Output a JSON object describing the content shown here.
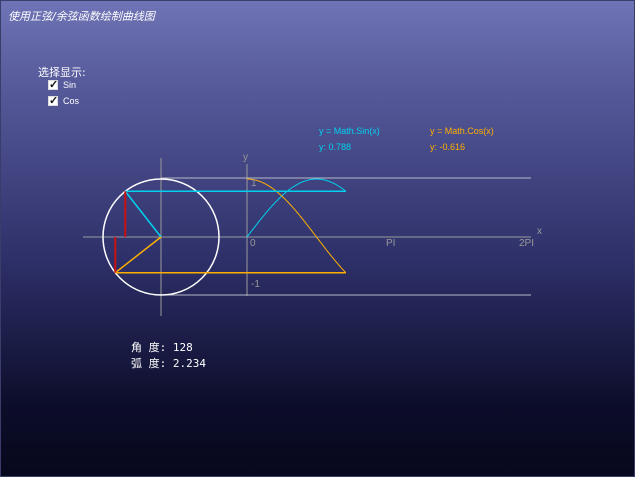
{
  "window": {
    "title": "使用正弦/余弦函数绘制曲线图"
  },
  "options": {
    "label": "选择显示:",
    "items": [
      {
        "label": "Sin",
        "checked": true
      },
      {
        "label": "Cos",
        "checked": true
      }
    ]
  },
  "legend": {
    "sin_formula": "y = Math.Sin(x)",
    "sin_value": "y: 0.788",
    "cos_formula": "y = Math.Cos(x)",
    "cos_value": "y: -0.616"
  },
  "axes": {
    "y_label": "y",
    "x_label": "x",
    "one": "1",
    "minus_one": "-1",
    "zero": "0",
    "pi": "PI",
    "two_pi": "2PI"
  },
  "readout": {
    "angle": "角 度: 128",
    "radian": "弧 度: 2.234"
  },
  "colors": {
    "sin": "#00d2ee",
    "cos": "#ffb000",
    "circle": "#ffffff",
    "axis": "#9a9a9a",
    "marker": "#cc1010"
  },
  "chart_data": {
    "type": "line",
    "xlabel": "x",
    "ylabel": "y",
    "angle_degrees": 128,
    "angle_radians": 2.234,
    "series": [
      {
        "name": "y = Math.Sin(x)",
        "function": "sin",
        "current_value": 0.788
      },
      {
        "name": "y = Math.Cos(x)",
        "function": "cos",
        "current_value": -0.616
      }
    ],
    "xlim": [
      0,
      6.283
    ],
    "ylim": [
      -1,
      1
    ]
  }
}
